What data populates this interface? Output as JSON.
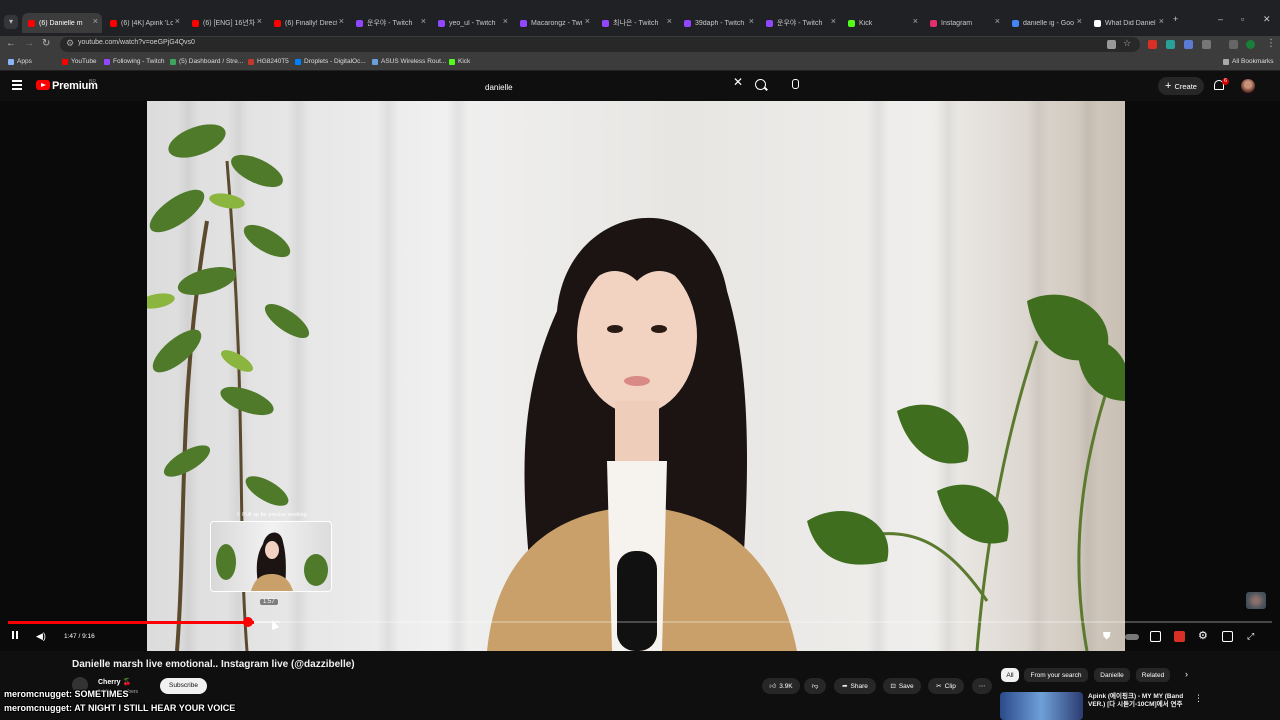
{
  "browser": {
    "tabs": [
      {
        "title": "(6) Danielle m",
        "active": true,
        "color": "#ff0000"
      },
      {
        "title": "(6) [4K] Apink 'Lo",
        "color": "#ff0000"
      },
      {
        "title": "(6) [ENG] 16년차",
        "color": "#ff0000"
      },
      {
        "title": "(6) Finally! Direct",
        "color": "#ff0000"
      },
      {
        "title": "운우야 - Twitch",
        "color": "#9146ff"
      },
      {
        "title": "yeo_ul - Twitch",
        "color": "#9146ff"
      },
      {
        "title": "Macarongz - Twi",
        "color": "#9146ff"
      },
      {
        "title": "최나은 - Twitch",
        "color": "#9146ff"
      },
      {
        "title": "39daph - Twitch",
        "color": "#9146ff"
      },
      {
        "title": "운우야 - Twitch",
        "color": "#9146ff"
      },
      {
        "title": "Kick",
        "color": "#53fc18"
      },
      {
        "title": "Instagram",
        "color": "#e1306c"
      },
      {
        "title": "danielle ig - Goo",
        "color": "#4285f4"
      },
      {
        "title": "What Did Daniel",
        "color": "#ffffff"
      }
    ],
    "new_tab": "+",
    "url": "youtube.com/watch?v=oeGPjG4Qvs0",
    "bookmarks": [
      {
        "label": "Apps",
        "color": "#8ab4f8"
      },
      {
        "label": "YouTube",
        "color": "#ff0000"
      },
      {
        "label": "Following - Twitch",
        "color": "#9146ff"
      },
      {
        "label": "(5) Dashboard / Stre...",
        "color": "#3ba55c"
      },
      {
        "label": "HG8240T5",
        "color": "#c0392b"
      },
      {
        "label": "Droplets - DigitalOc...",
        "color": "#0080ff"
      },
      {
        "label": "ASUS Wireless Rout...",
        "color": "#6aa0d8"
      },
      {
        "label": "Kick",
        "color": "#53fc18"
      }
    ],
    "all_bookmarks": "All Bookmarks"
  },
  "youtube": {
    "brand": "Premium",
    "brand_country": "BR",
    "search_value": "danielle",
    "create_label": "Create",
    "notification_count": "6"
  },
  "player": {
    "preview_hint": "⇧ Pull up for precise seeking",
    "preview_time": "1:57",
    "time_display": "1:47 / 9:16",
    "progress_played": 0.195,
    "progress_loaded": 0.215
  },
  "video": {
    "title": "Danielle marsh live emotional.. Instagram live (@dazzibelle)",
    "channel": "Cherry 🍒",
    "subscribers": "5.12K subscribers",
    "subscribe_label": "Subscribe",
    "likes": "3.9K",
    "share_label": "Share",
    "save_label": "Save",
    "clip_label": "Clip"
  },
  "chips": [
    "All",
    "From your search",
    "Danielle",
    "Related"
  ],
  "recommendation": {
    "title": "Apink (에이핑크) - MY MY (Band VER.) [다 시듣기-10CM]에서 연주"
  },
  "chat": [
    {
      "user": "meromcnugget:",
      "message": "SOMETIMES"
    },
    {
      "user": "meromcnugget:",
      "message": "AT NIGHT I STILL HEAR YOUR VOICE"
    }
  ]
}
